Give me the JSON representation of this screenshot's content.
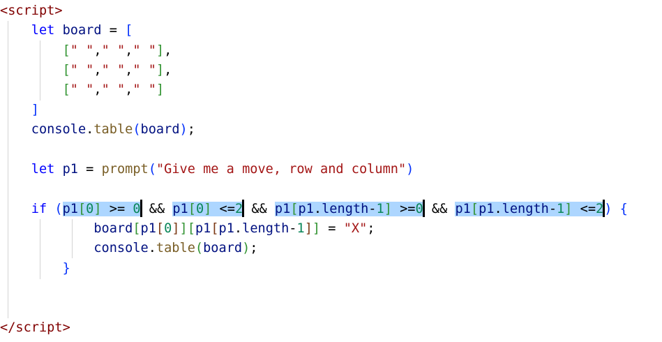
{
  "editor": {
    "lines": [
      {
        "tokens": [
          [
            "<",
            "t-tag"
          ],
          [
            "script",
            "t-tag"
          ],
          [
            ">",
            "t-tag"
          ]
        ]
      },
      {
        "tokens": [
          [
            "    ",
            "t-plain"
          ],
          [
            "let",
            "t-kw"
          ],
          [
            " ",
            "t-plain"
          ],
          [
            "board",
            "t-var"
          ],
          [
            " = ",
            "t-plain"
          ],
          [
            "[",
            "t-b1"
          ]
        ]
      },
      {
        "tokens": [
          [
            "        ",
            "t-plain"
          ],
          [
            "[",
            "t-b2"
          ],
          [
            "\" \"",
            "t-str"
          ],
          [
            ",",
            "t-punc"
          ],
          [
            "\" \"",
            "t-str"
          ],
          [
            ",",
            "t-punc"
          ],
          [
            "\" \"",
            "t-str"
          ],
          [
            "]",
            "t-b2"
          ],
          [
            ",",
            "t-punc"
          ]
        ]
      },
      {
        "tokens": [
          [
            "        ",
            "t-plain"
          ],
          [
            "[",
            "t-b2"
          ],
          [
            "\" \"",
            "t-str"
          ],
          [
            ",",
            "t-punc"
          ],
          [
            "\" \"",
            "t-str"
          ],
          [
            ",",
            "t-punc"
          ],
          [
            "\" \"",
            "t-str"
          ],
          [
            "]",
            "t-b2"
          ],
          [
            ",",
            "t-punc"
          ]
        ]
      },
      {
        "tokens": [
          [
            "        ",
            "t-plain"
          ],
          [
            "[",
            "t-b2"
          ],
          [
            "\" \"",
            "t-str"
          ],
          [
            ",",
            "t-punc"
          ],
          [
            "\" \"",
            "t-str"
          ],
          [
            ",",
            "t-punc"
          ],
          [
            "\" \"",
            "t-str"
          ],
          [
            "]",
            "t-b2"
          ]
        ]
      },
      {
        "tokens": [
          [
            "    ",
            "t-plain"
          ],
          [
            "]",
            "t-b1"
          ]
        ]
      },
      {
        "tokens": [
          [
            "    ",
            "t-plain"
          ],
          [
            "console",
            "t-var"
          ],
          [
            ".",
            "t-punc"
          ],
          [
            "table",
            "t-fn"
          ],
          [
            "(",
            "t-b1"
          ],
          [
            "board",
            "t-var"
          ],
          [
            ")",
            "t-b1"
          ],
          [
            ";",
            "t-punc"
          ]
        ]
      },
      {
        "tokens": []
      },
      {
        "tokens": [
          [
            "    ",
            "t-plain"
          ],
          [
            "let",
            "t-kw"
          ],
          [
            " ",
            "t-plain"
          ],
          [
            "p1",
            "t-var"
          ],
          [
            " = ",
            "t-plain"
          ],
          [
            "prompt",
            "t-fn"
          ],
          [
            "(",
            "t-b1"
          ],
          [
            "\"Give me a move, row and column\"",
            "t-str"
          ],
          [
            ")",
            "t-b1"
          ]
        ]
      },
      {
        "tokens": []
      },
      {
        "tokens": [
          [
            "    ",
            "t-plain"
          ],
          [
            "if",
            "t-kw"
          ],
          [
            " ",
            "t-plain"
          ],
          [
            "(",
            "t-b1"
          ],
          [
            "p1",
            "t-var sel"
          ],
          [
            "[",
            "t-b2 sel"
          ],
          [
            "0",
            "t-num sel"
          ],
          [
            "]",
            "t-b2 sel"
          ],
          [
            " >= ",
            "t-plain sel"
          ],
          [
            "0",
            "t-num sel"
          ],
          [
            "|",
            "caret"
          ],
          [
            " && ",
            "t-plain"
          ],
          [
            "p1",
            "t-var sel"
          ],
          [
            "[",
            "t-b2 sel"
          ],
          [
            "0",
            "t-num sel"
          ],
          [
            "]",
            "t-b2 sel"
          ],
          [
            " <=",
            "t-plain sel"
          ],
          [
            "2",
            "t-num sel"
          ],
          [
            "|",
            "caret"
          ],
          [
            " && ",
            "t-plain"
          ],
          [
            "p1",
            "t-var sel"
          ],
          [
            "[",
            "t-b2 sel"
          ],
          [
            "p1",
            "t-var sel"
          ],
          [
            ".",
            "t-punc sel"
          ],
          [
            "length",
            "t-var sel"
          ],
          [
            "-",
            "t-plain sel"
          ],
          [
            "1",
            "t-num sel"
          ],
          [
            "]",
            "t-b2 sel"
          ],
          [
            " >=",
            "t-plain sel"
          ],
          [
            "0",
            "t-num sel"
          ],
          [
            "|",
            "caret"
          ],
          [
            " && ",
            "t-plain"
          ],
          [
            "p1",
            "t-var sel"
          ],
          [
            "[",
            "t-b2 sel"
          ],
          [
            "p1",
            "t-var sel"
          ],
          [
            ".",
            "t-punc sel"
          ],
          [
            "length",
            "t-var sel"
          ],
          [
            "-",
            "t-plain sel"
          ],
          [
            "1",
            "t-num sel"
          ],
          [
            "]",
            "t-b2 sel"
          ],
          [
            " <=",
            "t-plain sel"
          ],
          [
            "2",
            "t-num sel"
          ],
          [
            "|",
            "caret"
          ],
          [
            ")",
            "t-b1"
          ],
          [
            " ",
            "t-plain"
          ],
          [
            "{",
            "t-b1"
          ]
        ]
      },
      {
        "tokens": [
          [
            "            ",
            "t-plain"
          ],
          [
            "board",
            "t-var"
          ],
          [
            "[",
            "t-b2"
          ],
          [
            "p1",
            "t-var"
          ],
          [
            "[",
            "t-b3"
          ],
          [
            "0",
            "t-num"
          ],
          [
            "]",
            "t-b3"
          ],
          [
            "]",
            "t-b2"
          ],
          [
            "[",
            "t-b2"
          ],
          [
            "p1",
            "t-var"
          ],
          [
            "[",
            "t-b3"
          ],
          [
            "p1",
            "t-var"
          ],
          [
            ".",
            "t-punc"
          ],
          [
            "length",
            "t-var"
          ],
          [
            "-",
            "t-plain"
          ],
          [
            "1",
            "t-num"
          ],
          [
            "]",
            "t-b3"
          ],
          [
            "]",
            "t-b2"
          ],
          [
            " = ",
            "t-plain"
          ],
          [
            "\"X\"",
            "t-str"
          ],
          [
            ";",
            "t-punc"
          ]
        ]
      },
      {
        "tokens": [
          [
            "            ",
            "t-plain"
          ],
          [
            "console",
            "t-var"
          ],
          [
            ".",
            "t-punc"
          ],
          [
            "table",
            "t-fn"
          ],
          [
            "(",
            "t-b2"
          ],
          [
            "board",
            "t-var"
          ],
          [
            ")",
            "t-b2"
          ],
          [
            ";",
            "t-punc"
          ]
        ]
      },
      {
        "tokens": [
          [
            "        ",
            "t-plain"
          ],
          [
            "}",
            "t-b1"
          ]
        ]
      },
      {
        "tokens": []
      },
      {
        "tokens": []
      },
      {
        "tokens": [
          [
            "</",
            "t-tag"
          ],
          [
            "script",
            "t-tag"
          ],
          [
            ">",
            "t-tag"
          ]
        ]
      }
    ]
  }
}
